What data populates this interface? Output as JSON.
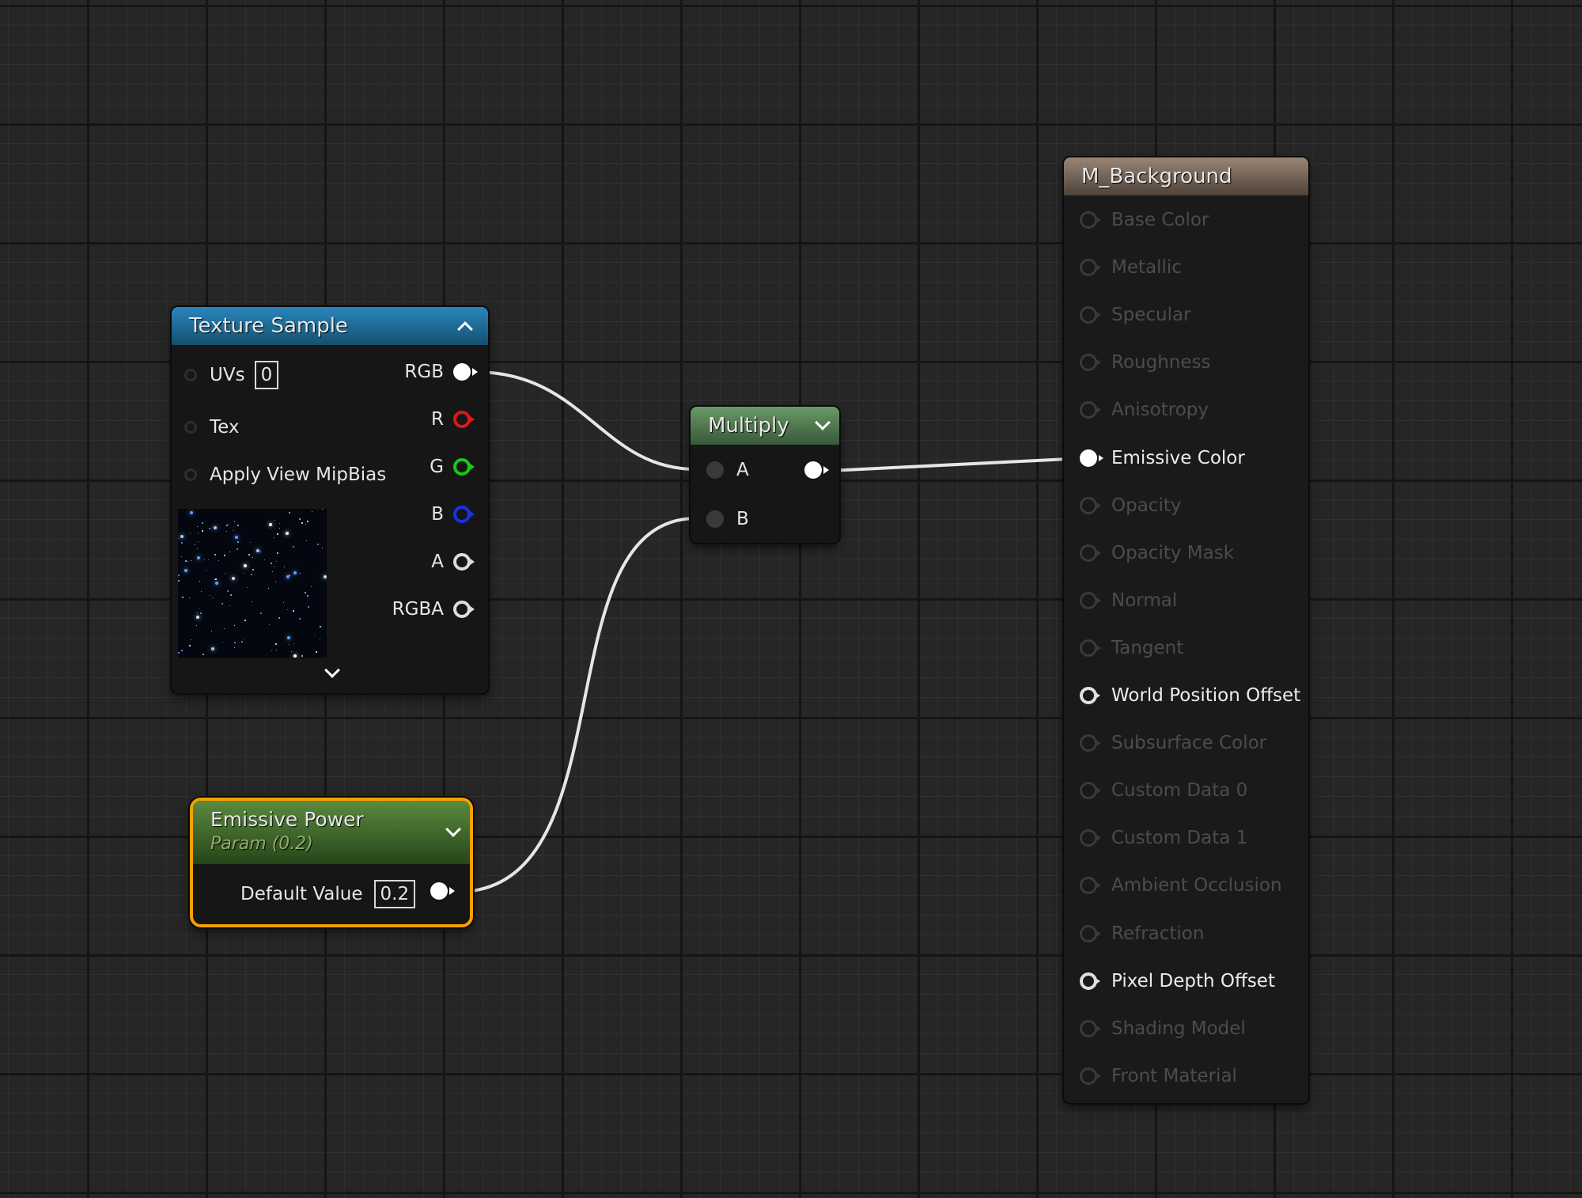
{
  "colors": {
    "texture_header": "#1b6c9a",
    "multiply_header": "#4e7a4e",
    "param_header": "#3b6c22",
    "result_header": "#7a6b60",
    "selection": "#f5a000",
    "wire": "#e6e6e6"
  },
  "texture_sample": {
    "title": "Texture Sample",
    "inputs": [
      {
        "label": "UVs",
        "value": "0"
      },
      {
        "label": "Tex"
      },
      {
        "label": "Apply View MipBias"
      }
    ],
    "outputs": [
      "RGB",
      "R",
      "G",
      "B",
      "A",
      "RGBA"
    ],
    "preview_icon": "starfield-texture-thumbnail"
  },
  "multiply": {
    "title": "Multiply",
    "inputs": [
      "A",
      "B"
    ]
  },
  "emissive_power": {
    "title": "Emissive Power",
    "subtitle": "Param (0.2)",
    "default_label": "Default Value",
    "default_value": "0.2"
  },
  "result": {
    "title": "M_Background",
    "pins": [
      {
        "label": "Base Color",
        "state": "off"
      },
      {
        "label": "Metallic",
        "state": "off"
      },
      {
        "label": "Specular",
        "state": "off"
      },
      {
        "label": "Roughness",
        "state": "off"
      },
      {
        "label": "Anisotropy",
        "state": "off"
      },
      {
        "label": "Emissive Color",
        "state": "connected"
      },
      {
        "label": "Opacity",
        "state": "off"
      },
      {
        "label": "Opacity Mask",
        "state": "off"
      },
      {
        "label": "Normal",
        "state": "off"
      },
      {
        "label": "Tangent",
        "state": "off"
      },
      {
        "label": "World Position Offset",
        "state": "active"
      },
      {
        "label": "Subsurface Color",
        "state": "off"
      },
      {
        "label": "Custom Data 0",
        "state": "off"
      },
      {
        "label": "Custom Data 1",
        "state": "off"
      },
      {
        "label": "Ambient Occlusion",
        "state": "off"
      },
      {
        "label": "Refraction",
        "state": "off"
      },
      {
        "label": "Pixel Depth Offset",
        "state": "active"
      },
      {
        "label": "Shading Model",
        "state": "off"
      },
      {
        "label": "Front Material",
        "state": "off"
      }
    ]
  }
}
